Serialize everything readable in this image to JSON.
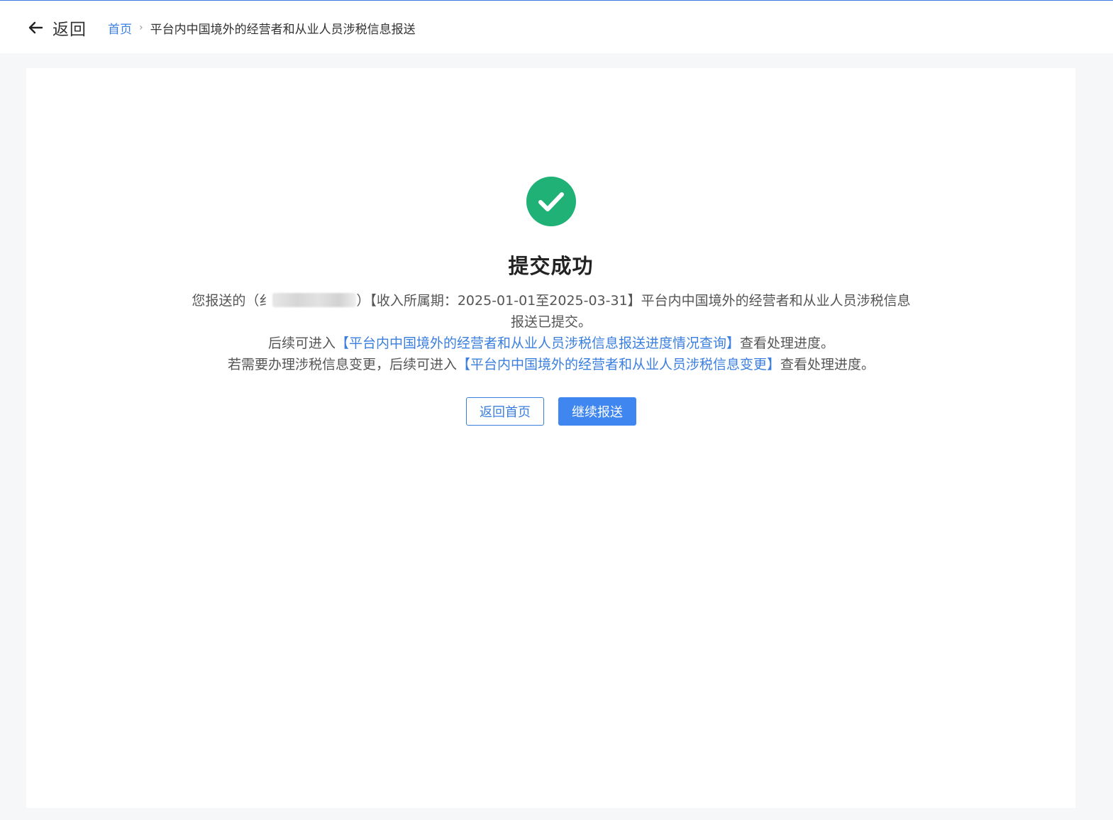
{
  "header": {
    "back_label": "返回",
    "breadcrumb": {
      "home": "首页",
      "separator": "›",
      "current": "平台内中国境外的经营者和从业人员涉税信息报送"
    }
  },
  "result": {
    "status": "success",
    "title": "提交成功",
    "line1_prefix": "您报送的（",
    "line1_masked_start": "纟",
    "line1_after_mask": "）【收入所属期：2025-01-01至2025-03-31】平台内中国境外的经营者和从业人员涉税信息报送已提交。",
    "line2_prefix": "后续可进入",
    "line2_link": "【平台内中国境外的经营者和从业人员涉税信息报送进度情况查询】",
    "line2_suffix": "查看处理进度。",
    "line3_prefix": "若需要办理涉税信息变更，后续可进入",
    "line3_link": "【平台内中国境外的经营者和从业人员涉税信息变更】",
    "line3_suffix": "查看处理进度。"
  },
  "buttons": {
    "home": "返回首页",
    "continue": "继续报送"
  },
  "colors": {
    "accent": "#3a7fe0",
    "success": "#1fb176",
    "primary_button": "#3f86f0"
  },
  "icons": {
    "back": "arrow-left-icon",
    "success": "check-circle-icon"
  }
}
